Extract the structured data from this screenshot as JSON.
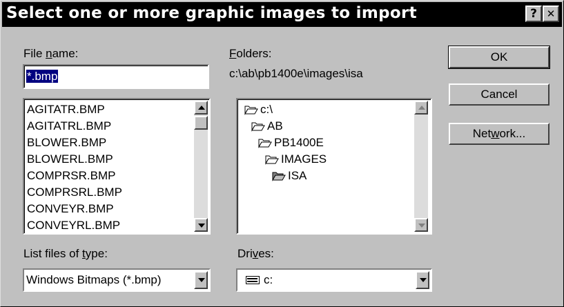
{
  "window": {
    "title": "Select one or more graphic images to import",
    "help_glyph": "?",
    "close_glyph": "✕"
  },
  "file_name": {
    "label_pre": "File ",
    "label_accel": "n",
    "label_post": "ame:",
    "value": "*.bmp",
    "files": [
      "AGITATR.BMP",
      "AGITATRL.BMP",
      "BLOWER.BMP",
      "BLOWERL.BMP",
      "COMPRSR.BMP",
      "COMPRSRL.BMP",
      "CONVEYR.BMP",
      "CONVEYRL.BMP"
    ]
  },
  "folders": {
    "label_accel": "F",
    "label_post": "olders:",
    "path": "c:\\ab\\pb1400e\\images\\isa",
    "tree": [
      {
        "label": "c:\\",
        "icon": "folder-open-icon"
      },
      {
        "label": "AB",
        "icon": "folder-open-icon"
      },
      {
        "label": "PB1400E",
        "icon": "folder-open-icon"
      },
      {
        "label": "IMAGES",
        "icon": "folder-open-icon"
      },
      {
        "label": "ISA",
        "icon": "folder-open-selected-icon"
      }
    ]
  },
  "file_type": {
    "label_pre": "List files of ",
    "label_accel": "t",
    "label_post": "ype:",
    "value": "Windows Bitmaps (*.bmp)"
  },
  "drives": {
    "label_pre": "Dri",
    "label_accel": "v",
    "label_post": "es:",
    "value": "c:",
    "icon": "drive-icon"
  },
  "buttons": {
    "ok": "OK",
    "cancel": "Cancel",
    "network_pre": "Net",
    "network_accel": "w",
    "network_post": "ork..."
  }
}
